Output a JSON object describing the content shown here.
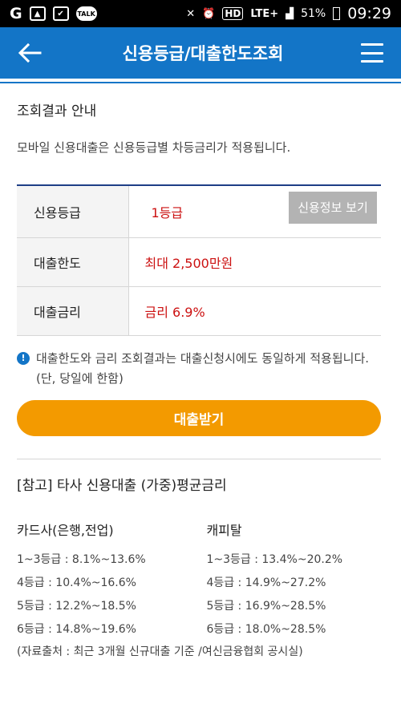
{
  "status_bar": {
    "icon_talk": "TALK",
    "icon_hd": "HD",
    "network": "LTE+",
    "battery": "51%",
    "time": "09:29"
  },
  "header": {
    "title": "신용등급/대출한도조회"
  },
  "main": {
    "section_title": "조회결과 안내",
    "description": "모바일 신용대출은 신용등급별 차등금리가 적용됩니다.",
    "table": {
      "grade_label": "신용등급",
      "grade_value": "1등급",
      "credit_info_button": "신용정보 보기",
      "limit_label": "대출한도",
      "limit_value": "최대 2,500만원",
      "rate_label": "대출금리",
      "rate_value": "금리 6.9%"
    },
    "notice": "대출한도와 금리 조회결과는 대출신청시에도 동일하게 적용됩니다.(단, 당일에 한함)",
    "loan_button": "대출받기"
  },
  "reference": {
    "title": "[참고] 타사 신용대출 (가중)평균금리",
    "card_header": "카드사(은행,전업)",
    "capital_header": "캐피탈",
    "card_rates": [
      "1~3등급 : 8.1%~13.6%",
      "4등급 : 10.4%~16.6%",
      "5등급 : 12.2%~18.5%",
      "6등급 : 14.8%~19.6%"
    ],
    "capital_rates": [
      "1~3등급 : 13.4%~20.2%",
      "4등급 : 14.9%~27.2%",
      "5등급 : 16.9%~28.5%",
      "6등급 : 18.0%~28.5%"
    ],
    "source": "(자료출처 : 최근 3개월 신규대출 기준 /여신금융협회 공시실)"
  },
  "colors": {
    "header_bg": "#1375c7",
    "value_red": "#cc1111",
    "loan_button": "#f39a00",
    "credit_button": "#b3b3b3"
  }
}
